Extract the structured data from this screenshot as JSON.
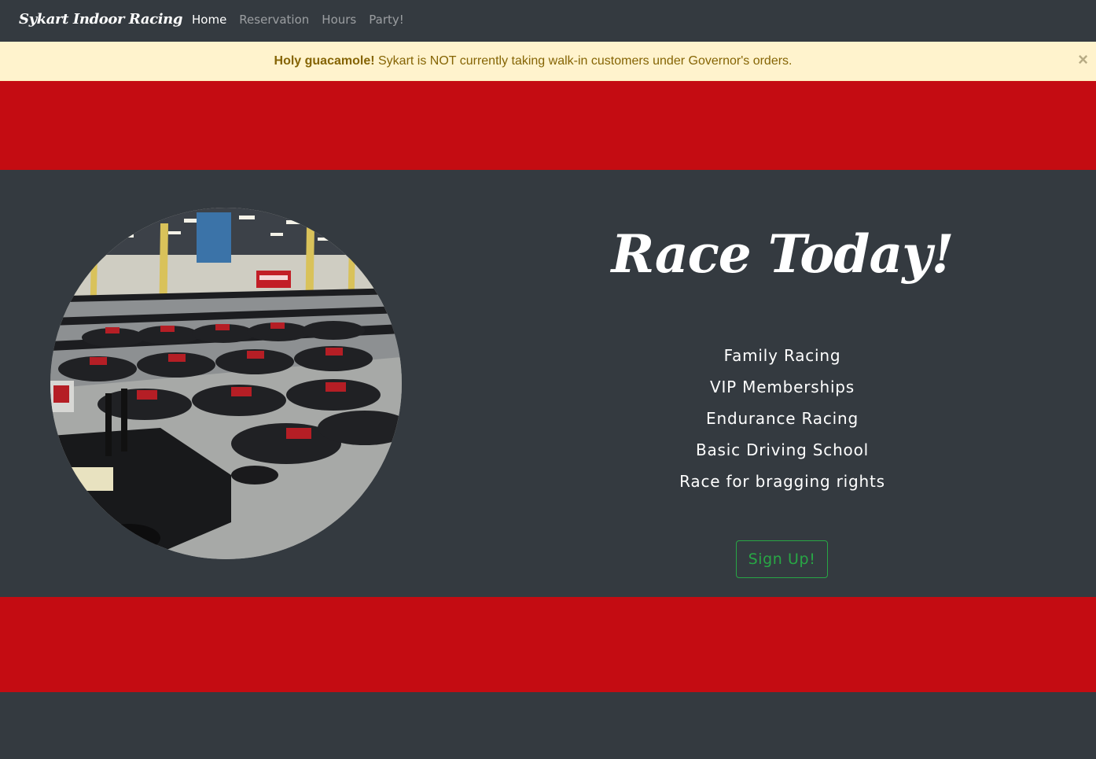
{
  "navbar": {
    "brand": "Sykart Indoor Racing",
    "links": [
      {
        "label": "Home"
      },
      {
        "label": "Reservation"
      },
      {
        "label": "Hours"
      },
      {
        "label": "Party!"
      }
    ]
  },
  "alert": {
    "strong": "Holy guacamole!",
    "message": " Sykart is NOT currently taking walk-in customers under Governor's orders.",
    "close": "×"
  },
  "hero": {
    "title": "Race Today!",
    "features": [
      "Family Racing",
      "VIP Memberships",
      "Endurance Racing",
      "Basic Driving School",
      "Race for bragging rights"
    ],
    "signup_label": "Sign Up!"
  },
  "colors": {
    "dark": "#343a40",
    "red_band": "#c40c12",
    "alert_bg": "#fff3cd",
    "alert_text": "#856404",
    "success": "#28a745"
  },
  "icons": {
    "alert_close": "close-icon"
  }
}
